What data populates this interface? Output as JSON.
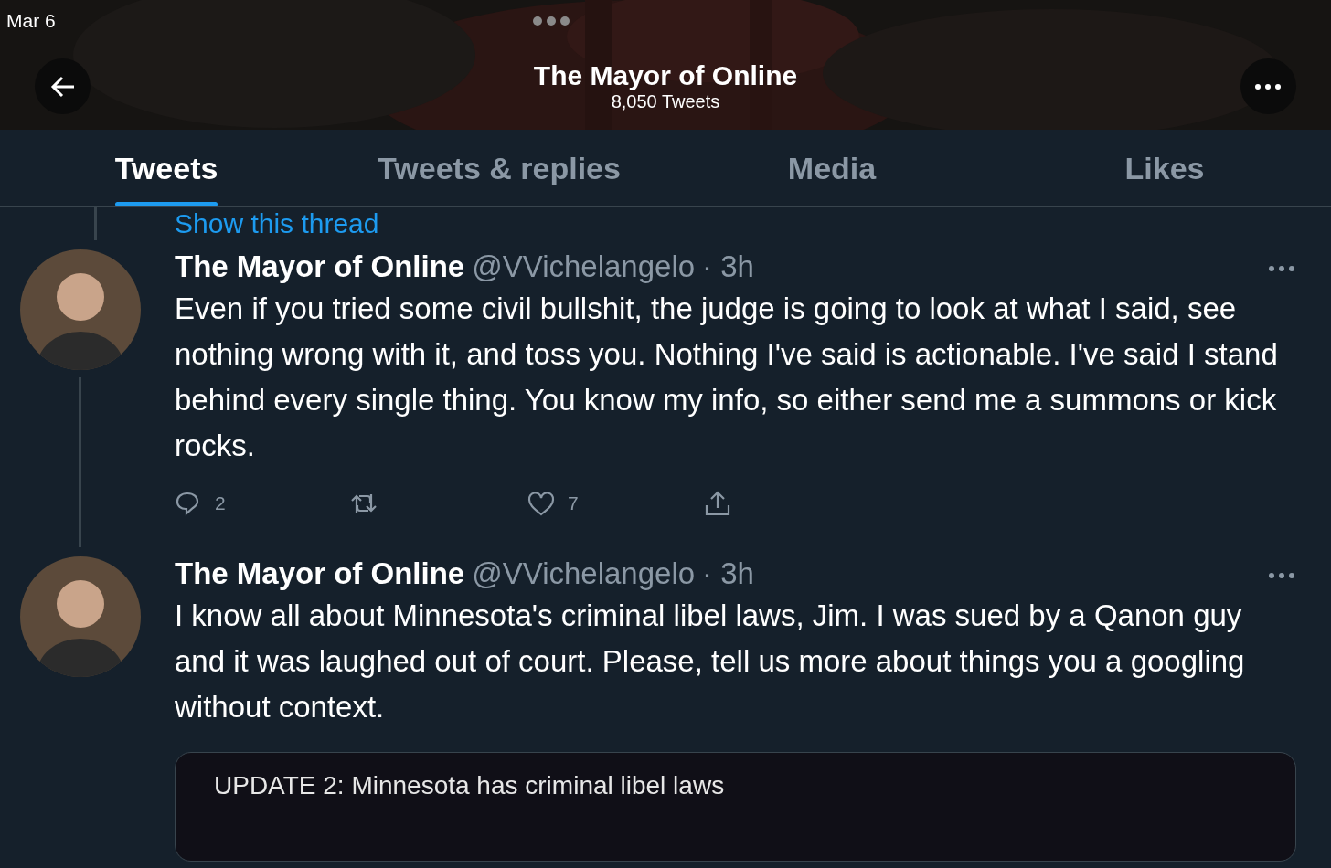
{
  "status_bar": {
    "date": "Mar 6"
  },
  "header": {
    "title": "The Mayor of Online",
    "subtitle": "8,050 Tweets"
  },
  "tabs": [
    {
      "label": "Tweets",
      "selected": true
    },
    {
      "label": "Tweets & replies",
      "selected": false
    },
    {
      "label": "Media",
      "selected": false
    },
    {
      "label": "Likes",
      "selected": false
    }
  ],
  "thread_link": "Show this thread",
  "tweets": [
    {
      "name": "The Mayor of Online",
      "handle": "@VVichelangelo",
      "time": "· 3h",
      "text": "Even if you tried some civil bullshit, the judge is going to look at what I said, see nothing wrong with it, and toss you. Nothing I've said is actionable. I've said I stand behind every single thing. You know my info, so either send me a summons or kick rocks.",
      "thread_below": true,
      "replies": "2",
      "likes": "7"
    },
    {
      "name": "The Mayor of Online",
      "handle": "@VVichelangelo",
      "time": "· 3h",
      "text": "I know all about Minnesota's criminal libel laws, Jim. I was sued by a Qanon guy and it was laughed out of court. Please, tell us more about things you a googling without context.",
      "thread_below": false,
      "card": {
        "title": "UPDATE 2: Minnesota has criminal libel laws"
      }
    }
  ]
}
